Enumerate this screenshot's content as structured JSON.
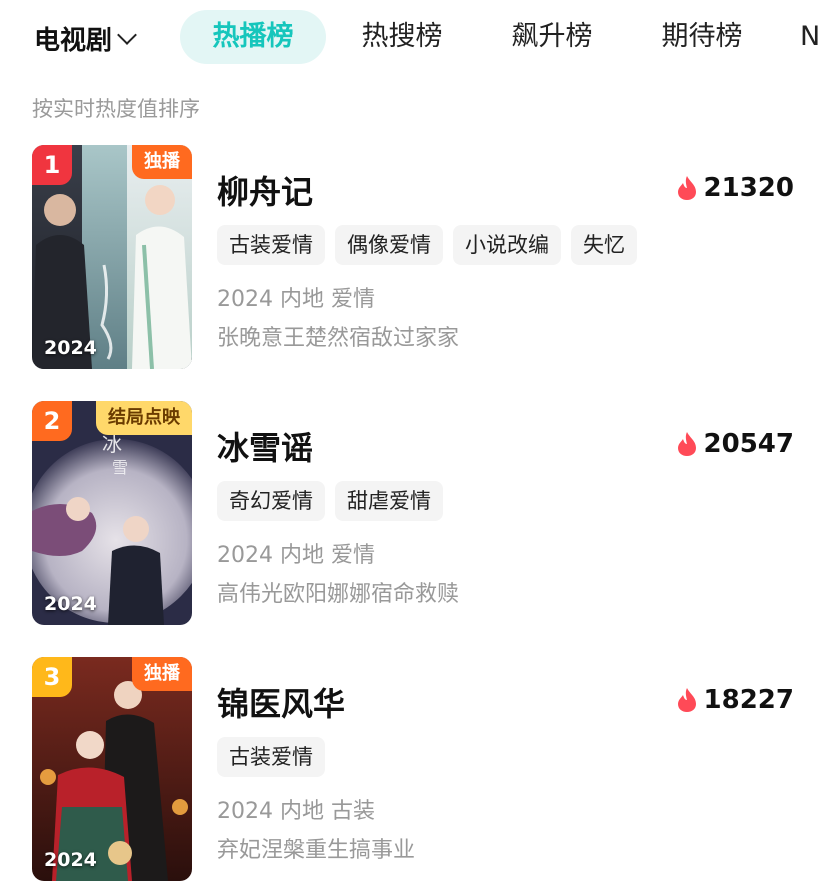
{
  "header": {
    "category": "电视剧",
    "tabs": [
      {
        "label": "热播榜",
        "active": true
      },
      {
        "label": "热搜榜",
        "active": false
      },
      {
        "label": "飙升榜",
        "active": false
      },
      {
        "label": "期待榜",
        "active": false
      },
      {
        "label": "N",
        "active": false
      }
    ],
    "subtitle": "按实时热度值排序"
  },
  "colors": {
    "accent": "#16c6bc",
    "accent_bg": "#e3f6f5",
    "flame": "#ff4a57",
    "rank1": "#f0353f",
    "rank2": "#ff6a1f",
    "rank3": "#ffb81a",
    "badge_exclusive": "#ff6a1f",
    "badge_finale": "#ffd86a"
  },
  "items": [
    {
      "rank": "1",
      "badge": "独播",
      "year_overlay": "2024",
      "title": "柳舟记",
      "heat": "21320",
      "tags": [
        "古装爱情",
        "偶像爱情",
        "小说改编",
        "失忆"
      ],
      "meta": "2024 内地 爱情",
      "desc": "张晚意王楚然宿敌过家家"
    },
    {
      "rank": "2",
      "badge": "结局点映",
      "year_overlay": "2024",
      "title": "冰雪谣",
      "heat": "20547",
      "tags": [
        "奇幻爱情",
        "甜虐爱情"
      ],
      "meta": "2024 内地 爱情",
      "desc": "高伟光欧阳娜娜宿命救赎"
    },
    {
      "rank": "3",
      "badge": "独播",
      "year_overlay": "2024",
      "title": "锦医风华",
      "heat": "18227",
      "tags": [
        "古装爱情"
      ],
      "meta": "2024 内地 古装",
      "desc": "弃妃涅槃重生搞事业"
    }
  ]
}
